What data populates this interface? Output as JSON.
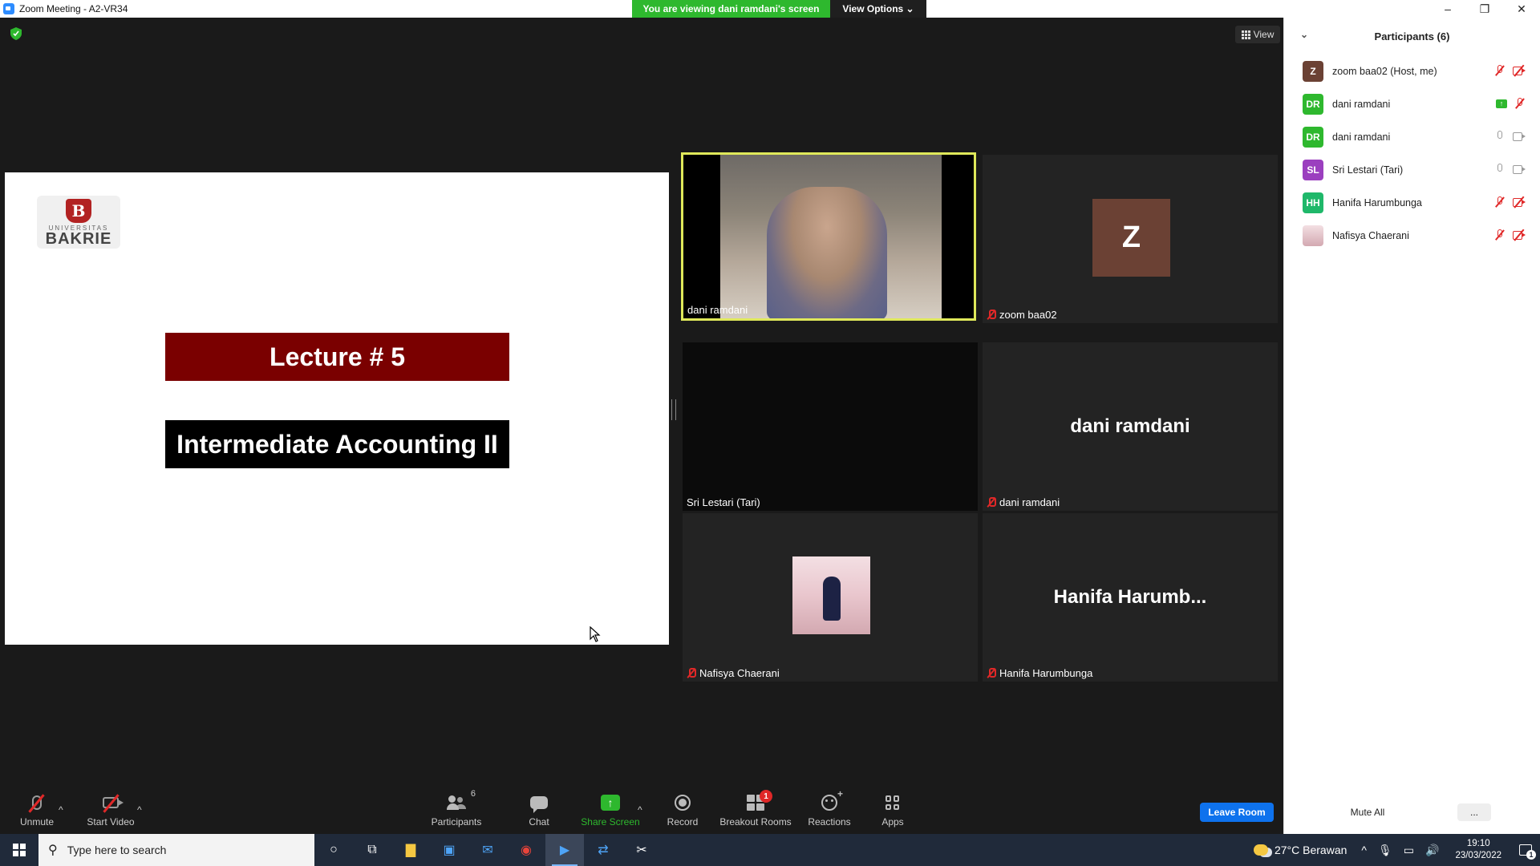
{
  "window": {
    "title": "Zoom Meeting - A2-VR34",
    "minimize": "–",
    "restore": "❐",
    "close": "✕"
  },
  "banner": {
    "viewing_text": "You are viewing dani ramdani's screen",
    "view_options": "View Options ⌄"
  },
  "view_button": "View",
  "slide": {
    "logo_university": "UNIVERSITAS",
    "logo_name": "BAKRIE",
    "logo_emblem": "B",
    "lecture": "Lecture # 5",
    "course": "Intermediate Accounting II"
  },
  "tiles": [
    {
      "name": "dani ramdani"
    },
    {
      "name": "zoom baa02",
      "avatar": "Z"
    },
    {
      "name": "Sri Lestari (Tari)"
    },
    {
      "name": "dani ramdani",
      "big_name": "dani ramdani"
    },
    {
      "name": "Nafisya Chaerani"
    },
    {
      "name": "Hanifa Harumbunga",
      "big_name": "Hanifa  Harumb..."
    }
  ],
  "toolbar": {
    "unmute": "Unmute",
    "start_video": "Start Video",
    "participants": "Participants",
    "participants_count": "6",
    "chat": "Chat",
    "share_screen": "Share Screen",
    "share_icon": "↑",
    "record": "Record",
    "breakout_rooms": "Breakout Rooms",
    "breakout_badge": "1",
    "reactions": "Reactions",
    "apps": "Apps",
    "caret": "^",
    "leave": "Leave Room"
  },
  "panel": {
    "title": "Participants (6)",
    "collapse": "⌄",
    "participants": [
      {
        "initials": "Z",
        "name": "zoom baa02 (Host, me)",
        "color": "#6b4134"
      },
      {
        "initials": "DR",
        "name": "dani ramdani",
        "color": "#2eb82e"
      },
      {
        "initials": "DR",
        "name": "dani ramdani",
        "color": "#2eb82e"
      },
      {
        "initials": "SL",
        "name": "Sri Lestari (Tari)",
        "color": "#9b3fbf"
      },
      {
        "initials": "HH",
        "name": "Hanifa Harumbunga",
        "color": "#1fb86a"
      },
      {
        "initials": "",
        "name": "Nafisya Chaerani",
        "color": "#e9c6cd"
      }
    ],
    "mute_all": "Mute All",
    "more": "..."
  },
  "taskbar": {
    "search_placeholder": "Type here to search",
    "weather": "27°C  Berawan",
    "time": "19:10",
    "date": "23/03/2022",
    "notifications": "1",
    "tray_caret": "^"
  }
}
